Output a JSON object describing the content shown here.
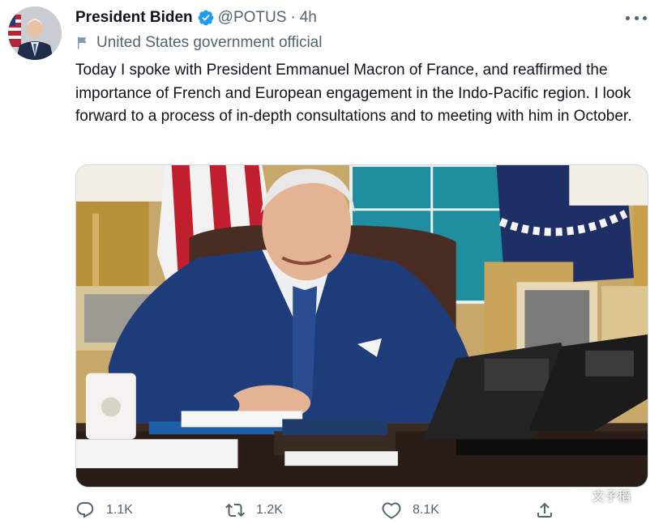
{
  "account": {
    "display_name": "President Biden",
    "handle": "@POTUS",
    "separator": "·",
    "timestamp": "4h",
    "verified": true,
    "label": "United States government official"
  },
  "tweet": {
    "text": "Today I spoke with President Emmanuel Macron of France, and reaffirmed the importance of French and European engagement in the Indo-Pacific region. I look forward to a process of in-depth consultations and to meeting with him in October."
  },
  "media": {
    "kind": "photo",
    "subject": "President seated at desk with telephones, flags in background"
  },
  "actions": {
    "replies": "1.1K",
    "retweets": "1.2K",
    "likes": "8.1K"
  },
  "watermark": {
    "text": "文子稻",
    "icon": "wechat-icon"
  },
  "colors": {
    "text_primary": "#0f1419",
    "text_secondary": "#536471",
    "verified_blue": "#1d9bf0"
  },
  "icons": {
    "verified": "verified-badge-icon",
    "more": "more-options-icon",
    "flag": "flag-icon",
    "reply": "reply-icon",
    "retweet": "retweet-icon",
    "like": "heart-icon",
    "share": "share-icon"
  }
}
